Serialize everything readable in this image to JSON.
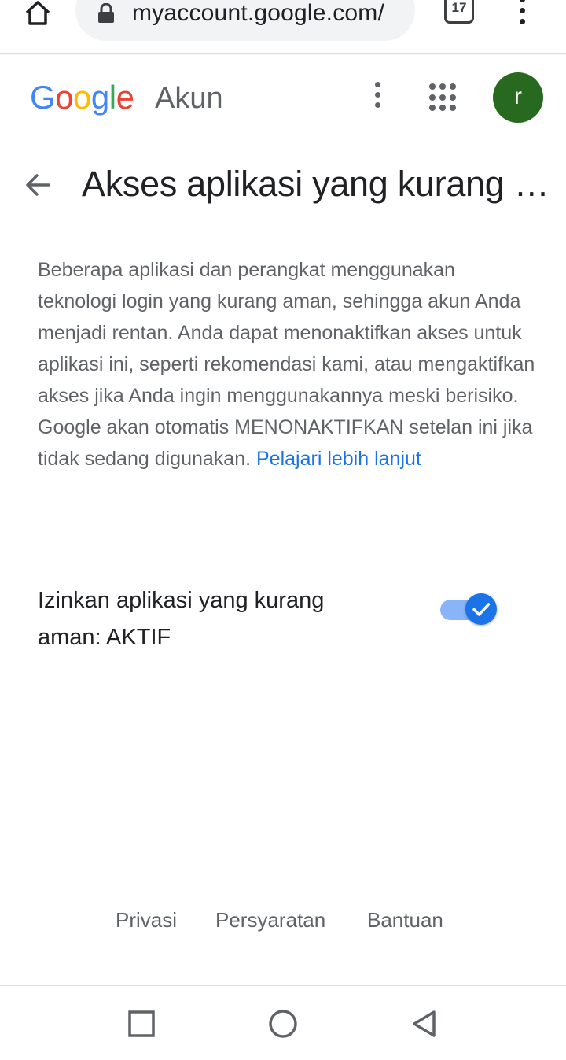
{
  "browser": {
    "url": "myaccount.google.com/",
    "tab_count": "17",
    "icons": [
      "home-icon",
      "lock-icon",
      "tab-switcher-icon",
      "more-vert-icon"
    ]
  },
  "header": {
    "logo_text": "Google",
    "product_name": "Akun",
    "avatar_initial": "r",
    "avatar_color": "#276a1f"
  },
  "page": {
    "title": "Akses aplikasi yang kurang aman",
    "description": "Beberapa aplikasi dan perangkat menggunakan teknologi login yang kurang aman, sehingga akun Anda menjadi rentan. Anda dapat menonaktifkan akses untuk aplikasi ini, seperti rekomendasi kami, atau mengaktifkan akses jika Anda ingin menggunakannya meski berisiko. Google akan otomatis MENONAKTIFKAN setelan ini jika tidak sedang digunakan.",
    "learn_more": "Pelajari lebih lanjut"
  },
  "setting": {
    "label": "Izinkan aplikasi yang kurang aman: AKTIF",
    "toggle_on": true,
    "accent_color": "#1a73e8"
  },
  "footer": {
    "privacy": "Privasi",
    "terms": "Persyaratan",
    "help": "Bantuan"
  },
  "system_nav": {
    "icons": [
      "recents-icon",
      "home-circle-icon",
      "back-triangle-icon"
    ]
  }
}
